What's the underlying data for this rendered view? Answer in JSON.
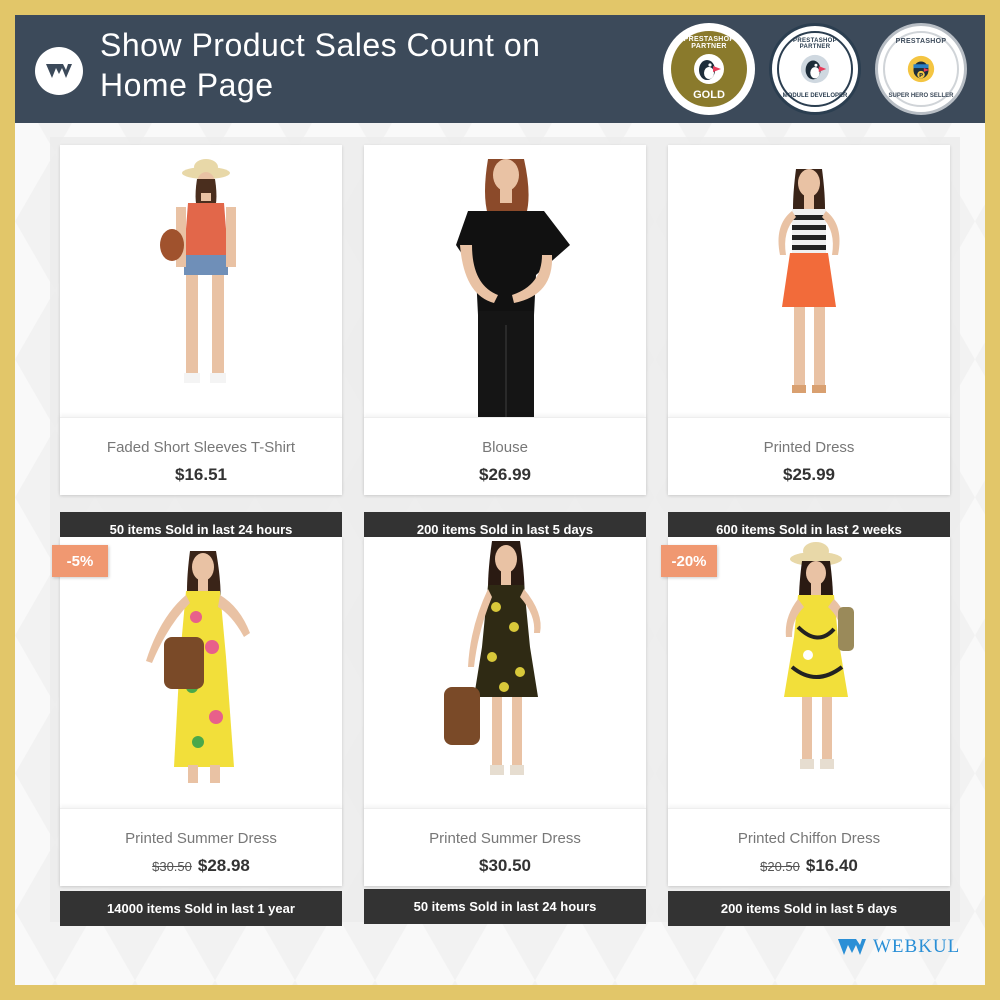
{
  "header": {
    "title": "Show Product Sales Count on Home Page",
    "background": "#3c4a5a",
    "badges": [
      {
        "name": "prestashop-partner-gold-badge",
        "ring": "PRESTASHOP PARTNER",
        "label": "GOLD",
        "color": "#8a7a2c"
      },
      {
        "name": "prestashop-partner-module-developer-badge",
        "ring": "PRESTASHOP PARTNER",
        "label": "MODULE DEVELOPER",
        "color": "#c0245a"
      },
      {
        "name": "prestashop-super-hero-seller-badge",
        "ring": "PRESTASHOP",
        "label": "SUPER HERO SELLER",
        "color": "#9aa3ad"
      }
    ]
  },
  "products": [
    {
      "name": "Faded Short Sleeves T-Shirt",
      "price": "$16.51",
      "old_price": "",
      "discount": "",
      "sold": "50 items Sold in last 24 hours",
      "outfit": "orange-top-shorts"
    },
    {
      "name": "Blouse",
      "price": "$26.99",
      "old_price": "",
      "discount": "",
      "sold": "200 items Sold in last 5 days",
      "outfit": "black-blouse"
    },
    {
      "name": "Printed Dress",
      "price": "$25.99",
      "old_price": "",
      "discount": "",
      "sold": "600 items Sold in last 2 weeks",
      "outfit": "striped-orange-dress"
    },
    {
      "name": "Printed Summer Dress",
      "price": "$28.98",
      "old_price": "$30.50",
      "discount": "-5%",
      "sold": "14000 items Sold in last 1 year",
      "outfit": "yellow-floral-maxi"
    },
    {
      "name": "Printed Summer Dress",
      "price": "$30.50",
      "old_price": "",
      "discount": "",
      "sold": "50 items Sold in last 24 hours",
      "outfit": "dark-floral-dress"
    },
    {
      "name": "Printed Chiffon Dress",
      "price": "$16.40",
      "old_price": "$20.50",
      "discount": "-20%",
      "sold": "200 items Sold in last 5 days",
      "outfit": "yellow-chiffon-dress"
    }
  ],
  "footer": {
    "brand": "WEBKUL",
    "brand_color": "#2a8fd6"
  },
  "colors": {
    "gold_border": "#e2c669",
    "sold_bar": "#333333",
    "discount_badge": "#f09871"
  }
}
